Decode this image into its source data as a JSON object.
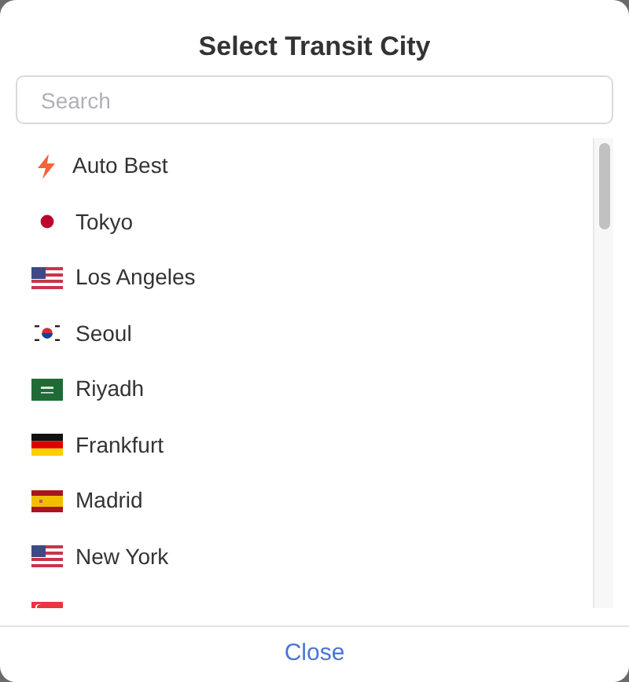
{
  "dialog": {
    "title": "Select Transit City"
  },
  "search": {
    "placeholder": "Search"
  },
  "cities": [
    {
      "kind": "bolt",
      "label": "Auto Best"
    },
    {
      "kind": "japan",
      "label": "Tokyo"
    },
    {
      "kind": "usa",
      "label": "Los Angeles"
    },
    {
      "kind": "korea",
      "label": "Seoul"
    },
    {
      "kind": "saudi",
      "label": "Riyadh"
    },
    {
      "kind": "germany",
      "label": "Frankfurt"
    },
    {
      "kind": "spain",
      "label": "Madrid"
    },
    {
      "kind": "usa",
      "label": "New York"
    },
    {
      "kind": "singapore"
    }
  ],
  "footer": {
    "button": "Close"
  }
}
